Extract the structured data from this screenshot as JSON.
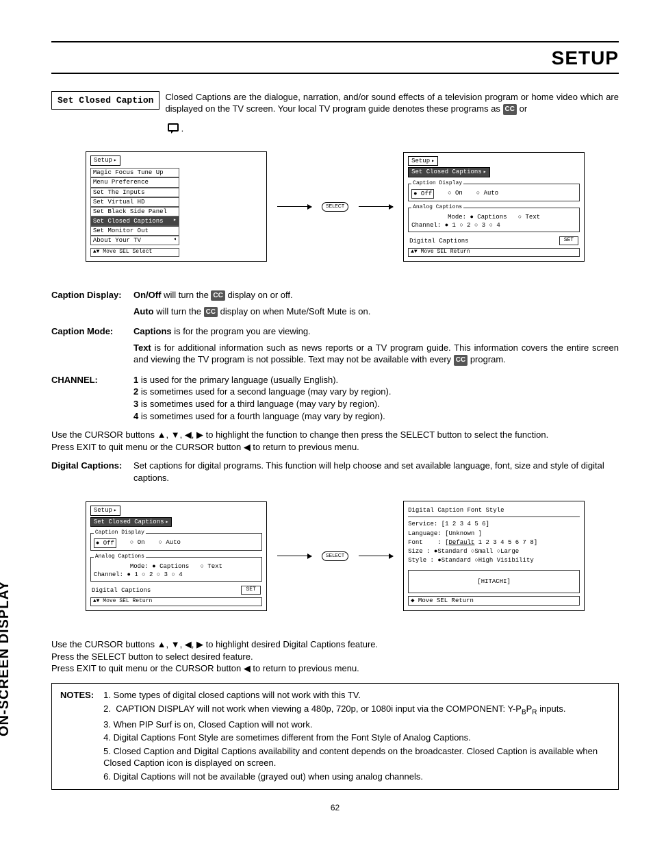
{
  "header": {
    "title": "SETUP"
  },
  "side_tab": "ON-SCREEN DISPLAY",
  "page_number": "62",
  "label_box": "Set Closed Caption",
  "intro": {
    "text": "Closed Captions are the dialogue, narration, and/or sound effects of a television program or home video which are displayed on the TV screen.  Your local TV program guide denotes these programs as ",
    "or": " or"
  },
  "osd1": {
    "title": "Setup",
    "items": [
      "Magic Focus Tune Up",
      "Menu Preference",
      "Set The Inputs",
      "Set Virtual HD",
      "Set Black Side Panel",
      "Set Closed Captions",
      "Set Monitor Out",
      "About Your TV"
    ],
    "highlight_index": 5,
    "footer": "▲▼ Move  SEL Select"
  },
  "select_label": "SELECT",
  "osd2": {
    "title": "Setup",
    "sub": "Set Closed Captions",
    "grp1": {
      "legend": "Caption Display",
      "off": "Off",
      "on": "On",
      "auto": "Auto"
    },
    "grp2": {
      "legend": "Analog Captions",
      "mode_label": "Mode:",
      "captions": "Captions",
      "text": "Text",
      "channel_label": "Channel:",
      "ch": [
        "1",
        "2",
        "3",
        "4"
      ]
    },
    "dc_label": "Digital Captions",
    "set": "SET",
    "footer": "▲▼ Move  SEL Return"
  },
  "caption_display": {
    "term": "Caption Display:",
    "onoff_b": "On/Off",
    "onoff_t": " will turn the ",
    "onoff_t2": " display on or off.",
    "auto_b": "Auto",
    "auto_t": " will turn the ",
    "auto_t2": " display on when Mute/Soft Mute is on."
  },
  "caption_mode": {
    "term": "Caption Mode:",
    "captions_b": "Captions",
    "captions_t": " is for the program you are viewing.",
    "text_b": "Text",
    "text_t": " is for additional information such as news reports or a TV program guide.  This information covers the entire screen and viewing the TV program is not possible.  Text may not be available with every ",
    "text_t2": " program."
  },
  "channel": {
    "term": "CHANNEL:",
    "lines": [
      {
        "b": "1",
        "t": " is used for the primary language (usually English)."
      },
      {
        "b": "2",
        "t": " is sometimes used for a second language (may vary by region)."
      },
      {
        "b": "3",
        "t": " is sometimes used for a third language (may vary by region)."
      },
      {
        "b": "4",
        "t": " is sometimes used for a fourth language (may vary by region)."
      }
    ]
  },
  "cursor_para1a": "Use the CURSOR buttons ▲, ▼, ◀, ▶ to highlight the function to change then press the SELECT button to select the function.",
  "cursor_para1b": "Press EXIT to quit menu or the CURSOR button ◀ to return to previous menu.",
  "digital_captions": {
    "term": "Digital Captions:",
    "text": "Set captions for digital programs.  This function will help choose and set  available language, font, size and style of digital captions."
  },
  "osd3": {
    "title": "Digital Caption Font Style",
    "service": "Service:  [1 2 3 4 5 6]",
    "language": "Language: [Unknown    ]",
    "font": "Font    : [Default 1 2 3 4 5 6 7 8]",
    "size": "Size    : ●Standard ○Small  ○Large",
    "style": "Style   : ●Standard ○High Visibility",
    "preview": "[HITACHI]",
    "footer": "◆ Move  SEL Return"
  },
  "cursor_para2a": "Use the CURSOR buttons ▲, ▼, ◀, ▶ to highlight desired Digital Captions feature.",
  "cursor_para2b": "Press the SELECT button to select desired feature.",
  "cursor_para2c": "Press EXIT to quit menu or the CURSOR button ◀ to return to previous menu.",
  "notes": {
    "label": "NOTES:",
    "items": [
      "1.  Some types of digital closed captions will not work with this TV.",
      "2.  CAPTION DISPLAY will not work when viewing a 480p, 720p, or 1080i input via the COMPONENT: Y-PBPR inputs.",
      "3.  When PIP Surf is on, Closed Caption will not work.",
      "4.  Digital Captions Font Style are sometimes different from the Font Style of Analog Captions.",
      "5.  Closed Caption and Digital Captions availability and content depends on the broadcaster.  Closed Caption is available when Closed Caption icon is displayed on screen.",
      "6.  Digital Captions will not be available (grayed out) when using analog channels."
    ]
  }
}
